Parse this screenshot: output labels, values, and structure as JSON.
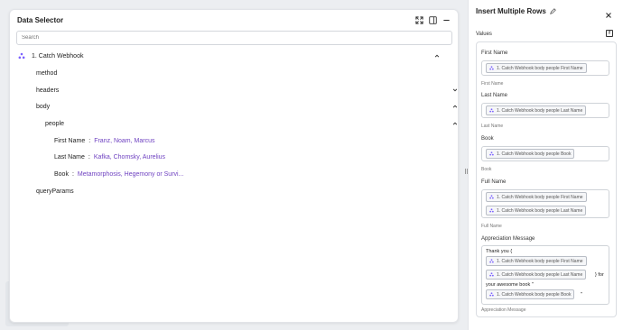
{
  "data_selector": {
    "title": "Data Selector",
    "search_placeholder": "Search",
    "trigger": {
      "label": "1. Catch Webhook"
    },
    "tree": {
      "method": "method",
      "headers": "headers",
      "body": "body",
      "people": "people",
      "first_name": {
        "key": "First Name",
        "value": "Franz, Noam, Marcus"
      },
      "last_name": {
        "key": "Last Name",
        "value": "Kafka, Chomsky, Aurelius"
      },
      "book": {
        "key": "Book",
        "value": "Metamorphosis, Hegemony or Survi..."
      },
      "query_params": "queryParams"
    }
  },
  "right_panel": {
    "title": "Insert Multiple Rows",
    "values_label": "Values",
    "fx_label": "f",
    "fields": {
      "first_name": {
        "label": "First Name",
        "chip": "1. Catch Webhook body people First Name",
        "hint": "First Name"
      },
      "last_name": {
        "label": "Last Name",
        "chip": "1. Catch Webhook body people Last Name",
        "hint": "Last Name"
      },
      "book": {
        "label": "Book",
        "chip": "1. Catch Webhook body people Book",
        "hint": "Book"
      },
      "full_name": {
        "label": "Full Name",
        "chip1": "1. Catch Webhook body people First Name",
        "chip2": "1. Catch Webhook body people Last Name",
        "hint": "Full Name"
      },
      "appreciation": {
        "label": "Appreciation Message",
        "text_start": "Thank you {",
        "chip1": "1. Catch Webhook body people First Name",
        "chip2": "1. Catch Webhook body people Last Name",
        "text_mid": "} for",
        "text_line3": "your awesome book \"",
        "chip3": "1. Catch Webhook body people Book",
        "text_end": "\"",
        "hint": "Appreciation Message"
      }
    }
  },
  "colors": {
    "accent": "#6f42c1",
    "chip_icon": "#7b61ff"
  },
  "icons": [
    "expand-icon",
    "dock-icon",
    "minimize-icon",
    "chevron-up-icon",
    "chevron-down-icon",
    "webhook-icon",
    "pencil-icon",
    "close-icon",
    "fx-icon"
  ]
}
